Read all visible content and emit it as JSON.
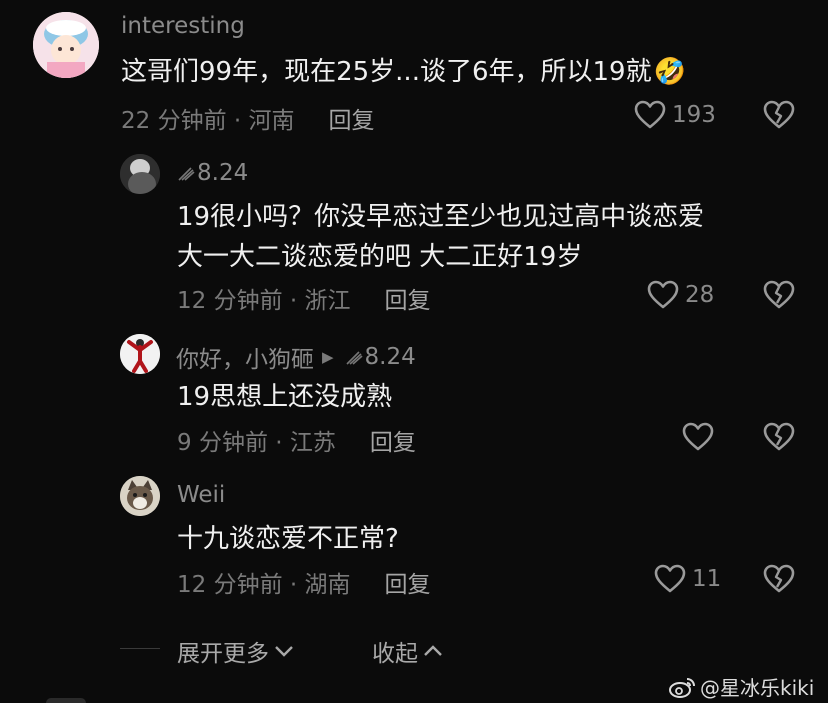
{
  "comments": [
    {
      "username": "interesting",
      "text_lines": [
        "这哥们99年，现在25岁...谈了6年，所以19就"
      ],
      "emoji": "🤣",
      "time_loc": "22 分钟前 · 河南",
      "reply_label": "回复",
      "likes": "193"
    },
    {
      "username": "8.24",
      "text_lines": [
        "19很小吗？你没早恋过至少也见过高中谈恋爱",
        "大一大二谈恋爱的吧  大二正好19岁"
      ],
      "time_loc": "12 分钟前 · 浙江",
      "reply_label": "回复",
      "likes": "28"
    },
    {
      "username": "你好，小狗砸",
      "reply_to": "8.24",
      "text_lines": [
        "19思想上还没成熟"
      ],
      "time_loc": "9 分钟前 · 江苏",
      "reply_label": "回复",
      "likes": ""
    },
    {
      "username": "Weii",
      "text_lines": [
        "十九谈恋爱不正常?"
      ],
      "time_loc": "12 分钟前 · 湖南",
      "reply_label": "回复",
      "likes": "11"
    }
  ],
  "footer": {
    "expand_more": "展开更多",
    "collapse": "收起"
  },
  "watermark": {
    "text": "@星冰乐kiki"
  },
  "colors": {
    "background": "#0b0b0b",
    "text": "#f0f0f0",
    "muted": "#7a7a7a"
  }
}
